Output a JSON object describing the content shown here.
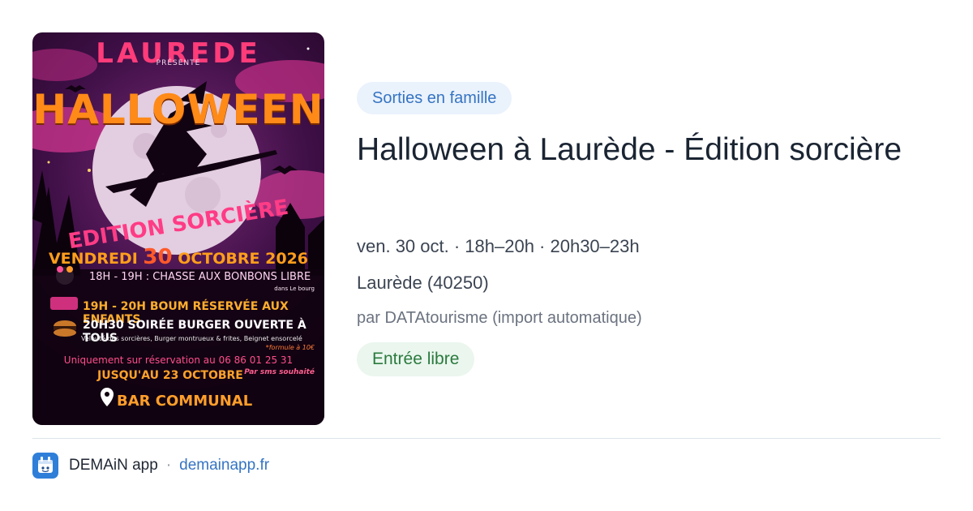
{
  "poster": {
    "alt_title": "Halloween",
    "host": "LAUREDE",
    "presents": "PRÉSENTE",
    "headline": "HALLOWEEN",
    "edition": "EDITION SORCIÈRE",
    "date_prefix": "VENDREDI",
    "date_day": "30",
    "date_suffix": "OCTOBRE 2026",
    "line1": "18H - 19H : CHASSE AUX BONBONS LIBRE",
    "line1_sub": "dans Le bourg",
    "line2": "19H - 20H BOUM RÉSERVÉE AUX ENFANTS",
    "line3": "20H30 SOIRÉE BURGER OUVERTE À TOUS",
    "line3_sub": "Velouté des sorcières, Burger montrueux & frites, Beignet ensorcelé",
    "line3_price": "*formule à 10€",
    "reservation": "Uniquement sur réservation au  06 86 01 25 31",
    "deadline": "JUSQU'AU 23 OCTOBRE",
    "sms": "Par sms souhaité",
    "venue": "BAR COMMUNAL"
  },
  "event": {
    "category": "Sorties en famille",
    "title": "Halloween à Laurède - Édition sorcière",
    "schedule": "ven. 30 oct. · 18h–20h · 20h30–23h",
    "location": "Laurède (40250)",
    "source": "par DATAtourisme (import automatique)",
    "price": "Entrée libre"
  },
  "footer": {
    "app_name": "DEMAiN app",
    "separator": "·",
    "domain": "demainapp.fr"
  },
  "colors": {
    "category_bg": "#eaf2fc",
    "category_text": "#3574c3",
    "price_bg": "#eaf6ee",
    "price_text": "#2b7a3e",
    "link": "#3574c3",
    "app_icon": "#2f7fd9"
  },
  "icons": {
    "poster_pin": "location-pin-icon",
    "app_logo": "demain-app-icon"
  }
}
